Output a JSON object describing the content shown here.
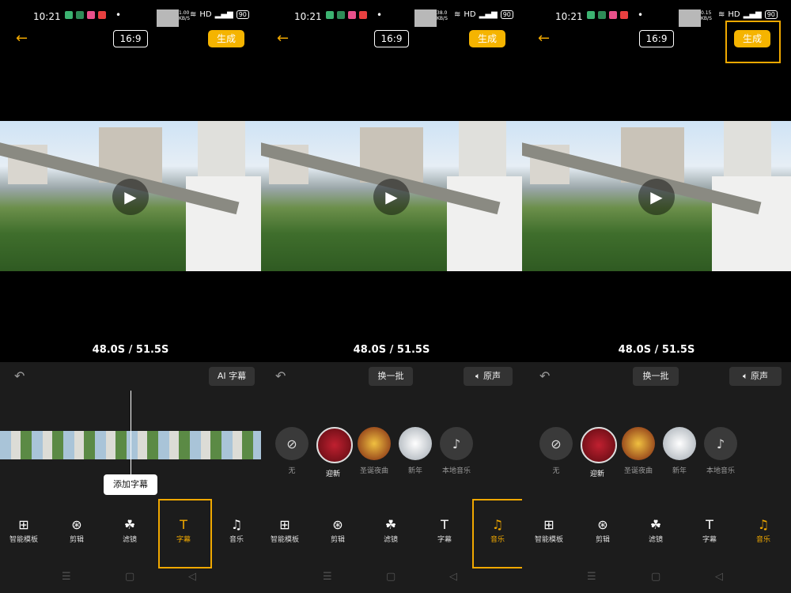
{
  "status": {
    "time": "10:21",
    "speeds": [
      "1.00",
      "38.0",
      "0.15"
    ],
    "speed_unit": "KB/S",
    "net": "HD",
    "battery": "90"
  },
  "topbar": {
    "ratio": "16:9",
    "generate_label": "生成",
    "back_icon": "back-arrow-icon"
  },
  "video": {
    "timer": "48.0S / 51.5S",
    "play_icon": "play-icon"
  },
  "panel1": {
    "ai_subtitle_label": "AI 字幕",
    "tooltip": "添加字幕"
  },
  "panel2": {
    "refresh_label": "换一批",
    "original_sound_label": "原声"
  },
  "music_items": [
    {
      "label": "无",
      "icon": "none-icon"
    },
    {
      "label": "迎新",
      "icon": "album-thumb"
    },
    {
      "label": "圣诞夜曲",
      "icon": "album-thumb"
    },
    {
      "label": "新年",
      "icon": "album-thumb"
    },
    {
      "label": "本地音乐",
      "icon": "music-note-icon"
    }
  ],
  "tabs": [
    {
      "label": "智能模板",
      "icon": "grid-icon"
    },
    {
      "label": "剪辑",
      "icon": "film-reel-icon"
    },
    {
      "label": "滤镜",
      "icon": "filter-icon"
    },
    {
      "label": "字幕",
      "icon": "text-icon"
    },
    {
      "label": "音乐",
      "icon": "music-icon"
    }
  ],
  "highlight_color": "#f0a800",
  "accent_button_color": "#f5b400"
}
